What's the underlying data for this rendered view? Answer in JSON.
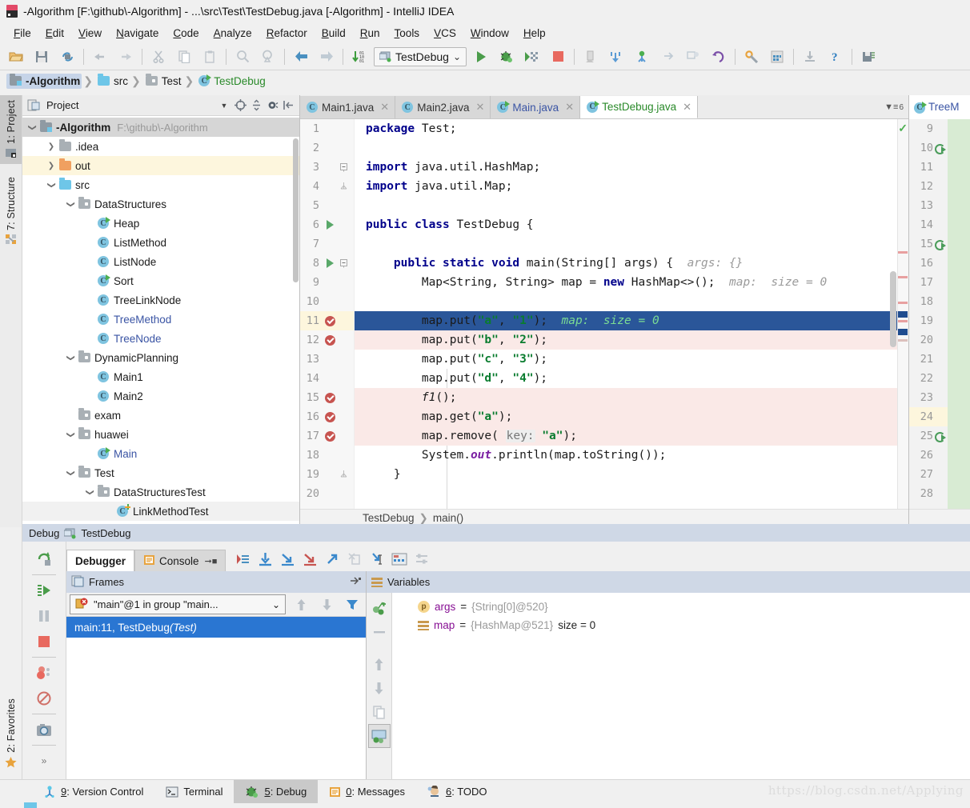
{
  "window": {
    "title": "-Algorithm [F:\\github\\-Algorithm] - ...\\src\\Test\\TestDebug.java [-Algorithm] - IntelliJ IDEA",
    "app_icon": "intellij-logo-icon"
  },
  "menubar": {
    "items": [
      "File",
      "Edit",
      "View",
      "Navigate",
      "Code",
      "Analyze",
      "Refactor",
      "Build",
      "Run",
      "Tools",
      "VCS",
      "Window",
      "Help"
    ]
  },
  "toolbar": {
    "buttons": [
      "open-folder-icon",
      "save-all-icon",
      "sync-icon",
      "undo-icon",
      "redo-icon",
      "cut-icon",
      "copy-icon",
      "paste-icon",
      "find-icon",
      "replace-icon",
      "back-icon",
      "forward-icon",
      "sort-icon"
    ],
    "run_config": {
      "label": "TestDebug",
      "icon": "run-configuration-icon",
      "chevron": "⌄"
    },
    "right_buttons": [
      "run-icon",
      "debug-icon",
      "run-coverage-icon",
      "stop-icon",
      "build-project-icon",
      "update-project-icon",
      "commit-icon",
      "push-icon",
      "rollback-icon",
      "revert-icon",
      "settings-icon",
      "project-structure-icon",
      "download-icon",
      "help-icon",
      "save-chip-icon"
    ]
  },
  "navbar": {
    "crumbs": [
      {
        "label": "-Algorithm",
        "icon": "project-folder-icon",
        "selected": true
      },
      {
        "label": "src",
        "icon": "source-folder-icon",
        "selected": false
      },
      {
        "label": "Test",
        "icon": "package-folder-icon",
        "selected": false
      },
      {
        "label": "TestDebug",
        "icon": "java-class-runnable-icon",
        "selected": false
      }
    ]
  },
  "left_stripe": {
    "top_buttons": [
      {
        "label": "1: Project",
        "key": "1",
        "icon": "project-tool-icon",
        "active": true
      },
      {
        "label": "7: Structure",
        "key": "7",
        "icon": "structure-tool-icon",
        "active": false
      }
    ],
    "bottom_buttons": [
      {
        "label": "2: Favorites",
        "key": "2",
        "icon": "favorites-star-icon",
        "active": false
      }
    ]
  },
  "project_panel": {
    "title": "Project",
    "header_icons": [
      "project-view-icon",
      "collapse-dropdown-icon",
      "locate-icon",
      "expand-collapse-icon",
      "gear-icon",
      "hide-icon"
    ],
    "tree": [
      {
        "depth": 0,
        "label": "-Algorithm",
        "sub": "F:\\github\\-Algorithm",
        "icon": "project-folder-icon",
        "chev": "down",
        "bold": true,
        "row": "selected-grey"
      },
      {
        "depth": 1,
        "label": ".idea",
        "icon": "folder-grey-icon",
        "chev": "right",
        "row": ""
      },
      {
        "depth": 1,
        "label": "out",
        "icon": "folder-orange-icon",
        "chev": "right",
        "row": "highlight"
      },
      {
        "depth": 1,
        "label": "src",
        "icon": "folder-blue-icon",
        "chev": "down",
        "row": ""
      },
      {
        "depth": 2,
        "label": "DataStructures",
        "icon": "package-folder-icon",
        "chev": "down",
        "row": ""
      },
      {
        "depth": 3,
        "label": "Heap",
        "icon": "java-class-runnable-icon",
        "chev": "",
        "row": ""
      },
      {
        "depth": 3,
        "label": "ListMethod",
        "icon": "java-class-icon",
        "chev": "",
        "row": ""
      },
      {
        "depth": 3,
        "label": "ListNode",
        "icon": "java-class-icon",
        "chev": "",
        "row": ""
      },
      {
        "depth": 3,
        "label": "Sort",
        "icon": "java-class-runnable-icon",
        "chev": "",
        "row": ""
      },
      {
        "depth": 3,
        "label": "TreeLinkNode",
        "icon": "java-class-icon",
        "chev": "",
        "row": ""
      },
      {
        "depth": 3,
        "label": "TreeMethod",
        "icon": "java-class-icon",
        "chev": "",
        "row": "",
        "blue": true
      },
      {
        "depth": 3,
        "label": "TreeNode",
        "icon": "java-class-icon",
        "chev": "",
        "row": "",
        "blue": true
      },
      {
        "depth": 2,
        "label": "DynamicPlanning",
        "icon": "package-folder-icon",
        "chev": "down",
        "row": ""
      },
      {
        "depth": 3,
        "label": "Main1",
        "icon": "java-class-icon",
        "chev": "",
        "row": ""
      },
      {
        "depth": 3,
        "label": "Main2",
        "icon": "java-class-icon",
        "chev": "",
        "row": ""
      },
      {
        "depth": 2,
        "label": "exam",
        "icon": "package-folder-icon",
        "chev": "",
        "row": ""
      },
      {
        "depth": 2,
        "label": "huawei",
        "icon": "package-folder-icon",
        "chev": "down",
        "row": ""
      },
      {
        "depth": 3,
        "label": "Main",
        "icon": "java-class-runnable-icon",
        "chev": "",
        "row": "",
        "blue": true
      },
      {
        "depth": 2,
        "label": "Test",
        "icon": "package-folder-icon",
        "chev": "down",
        "row": ""
      },
      {
        "depth": 3,
        "label": "DataStructuresTest",
        "icon": "package-folder-icon",
        "chev": "down",
        "row": ""
      },
      {
        "depth": 4,
        "label": "LinkMethodTest",
        "icon": "java-test-class-icon",
        "chev": "",
        "row": "faint"
      }
    ]
  },
  "editor": {
    "tabs": [
      {
        "label": "Main1.java",
        "icon": "java-class-icon",
        "active": false,
        "color": "grey"
      },
      {
        "label": "Main2.java",
        "icon": "java-class-icon",
        "active": false,
        "color": "grey"
      },
      {
        "label": "Main.java",
        "icon": "java-class-runnable-icon",
        "active": false,
        "color": "blue"
      },
      {
        "label": "TestDebug.java",
        "icon": "java-class-runnable-icon",
        "active": true,
        "color": "green"
      }
    ],
    "tab_overflow_label": "6",
    "inspection_status": "ok-check-icon",
    "breadcrumb": [
      "TestDebug",
      "main()"
    ],
    "lines": [
      {
        "n": 1,
        "indent": 0,
        "marker": "",
        "fold": "",
        "row": "",
        "tokens": [
          {
            "t": "kw",
            "v": "package"
          },
          {
            "t": "plain",
            "v": " Test;"
          }
        ]
      },
      {
        "n": 2,
        "indent": 0,
        "marker": "",
        "fold": "",
        "row": "",
        "tokens": []
      },
      {
        "n": 3,
        "indent": 0,
        "marker": "",
        "fold": "minus-open",
        "row": "",
        "tokens": [
          {
            "t": "kw",
            "v": "import"
          },
          {
            "t": "plain",
            "v": " java.util.HashMap;"
          }
        ]
      },
      {
        "n": 4,
        "indent": 0,
        "marker": "",
        "fold": "end",
        "row": "",
        "tokens": [
          {
            "t": "kw",
            "v": "import"
          },
          {
            "t": "plain",
            "v": " java.util.Map;"
          }
        ]
      },
      {
        "n": 5,
        "indent": 0,
        "marker": "",
        "fold": "",
        "row": "",
        "tokens": []
      },
      {
        "n": 6,
        "indent": 0,
        "marker": "run-arrow",
        "fold": "",
        "row": "",
        "tokens": [
          {
            "t": "kw",
            "v": "public class"
          },
          {
            "t": "plain",
            "v": " TestDebug {"
          }
        ]
      },
      {
        "n": 7,
        "indent": 0,
        "marker": "",
        "fold": "",
        "row": "",
        "tokens": []
      },
      {
        "n": 8,
        "indent": 1,
        "marker": "run-arrow",
        "fold": "minus-open",
        "row": "",
        "tokens": [
          {
            "t": "kw",
            "v": "public static void"
          },
          {
            "t": "plain",
            "v": " main(String[] args) {  "
          },
          {
            "t": "hint",
            "v": "args: {}"
          }
        ]
      },
      {
        "n": 9,
        "indent": 2,
        "marker": "",
        "fold": "",
        "row": "",
        "tokens": [
          {
            "t": "plain",
            "v": "Map<String, String> map = "
          },
          {
            "t": "kw",
            "v": "new"
          },
          {
            "t": "plain",
            "v": " HashMap<>();  "
          },
          {
            "t": "hint",
            "v": "map:  size = 0"
          }
        ]
      },
      {
        "n": 10,
        "indent": 0,
        "marker": "",
        "fold": "",
        "row": "",
        "tokens": []
      },
      {
        "n": 11,
        "indent": 2,
        "marker": "breakpoint",
        "fold": "",
        "row": "current",
        "tokens": [
          {
            "t": "plain",
            "v": "map.put("
          },
          {
            "t": "str",
            "v": "\"a\""
          },
          {
            "t": "plain",
            "v": ", "
          },
          {
            "t": "str",
            "v": "\"1\""
          },
          {
            "t": "plain",
            "v": ");  "
          },
          {
            "t": "hintg",
            "v": "map:  size = 0"
          }
        ]
      },
      {
        "n": 12,
        "indent": 2,
        "marker": "breakpoint",
        "fold": "",
        "row": "pink",
        "tokens": [
          {
            "t": "plain",
            "v": "map.put("
          },
          {
            "t": "str",
            "v": "\"b\""
          },
          {
            "t": "plain",
            "v": ", "
          },
          {
            "t": "str",
            "v": "\"2\""
          },
          {
            "t": "plain",
            "v": ");"
          }
        ]
      },
      {
        "n": 13,
        "indent": 2,
        "marker": "",
        "fold": "",
        "row": "",
        "tokens": [
          {
            "t": "plain",
            "v": "map.put("
          },
          {
            "t": "str",
            "v": "\"c\""
          },
          {
            "t": "plain",
            "v": ", "
          },
          {
            "t": "str",
            "v": "\"3\""
          },
          {
            "t": "plain",
            "v": ");"
          }
        ]
      },
      {
        "n": 14,
        "indent": 2,
        "marker": "",
        "fold": "",
        "row": "",
        "tokens": [
          {
            "t": "plain",
            "v": "map.put("
          },
          {
            "t": "str",
            "v": "\"d\""
          },
          {
            "t": "plain",
            "v": ", "
          },
          {
            "t": "str",
            "v": "\"4\""
          },
          {
            "t": "plain",
            "v": ");"
          }
        ]
      },
      {
        "n": 15,
        "indent": 2,
        "marker": "breakpoint",
        "fold": "",
        "row": "pink",
        "tokens": [
          {
            "t": "ital",
            "v": "f1"
          },
          {
            "t": "plain",
            "v": "();"
          }
        ]
      },
      {
        "n": 16,
        "indent": 2,
        "marker": "breakpoint",
        "fold": "",
        "row": "pink",
        "tokens": [
          {
            "t": "plain",
            "v": "map.get("
          },
          {
            "t": "str",
            "v": "\"a\""
          },
          {
            "t": "plain",
            "v": ");"
          }
        ]
      },
      {
        "n": 17,
        "indent": 2,
        "marker": "breakpoint",
        "fold": "",
        "row": "pink",
        "tokens": [
          {
            "t": "plain",
            "v": "map.remove( "
          },
          {
            "t": "pbadge",
            "v": "key:"
          },
          {
            "t": "plain",
            "v": " "
          },
          {
            "t": "str",
            "v": "\"a\""
          },
          {
            "t": "plain",
            "v": ");"
          }
        ]
      },
      {
        "n": 18,
        "indent": 2,
        "marker": "",
        "fold": "",
        "row": "",
        "tokens": [
          {
            "t": "plain",
            "v": "System."
          },
          {
            "t": "fld",
            "v": "out"
          },
          {
            "t": "plain",
            "v": ".println(map.toString());"
          }
        ]
      },
      {
        "n": 19,
        "indent": 1,
        "marker": "",
        "fold": "end",
        "row": "",
        "tokens": [
          {
            "t": "plain",
            "v": "}"
          }
        ]
      },
      {
        "n": 20,
        "indent": 0,
        "marker": "",
        "fold": "",
        "row": "",
        "tokens": []
      }
    ]
  },
  "right_editor": {
    "tab_label": "TreeM",
    "tab_icon": "java-class-runnable-icon",
    "lines": [
      {
        "n": 9,
        "icon": "",
        "row": ""
      },
      {
        "n": 10,
        "icon": "override-icon",
        "row": ""
      },
      {
        "n": 11,
        "icon": "",
        "row": ""
      },
      {
        "n": 12,
        "icon": "",
        "row": ""
      },
      {
        "n": 13,
        "icon": "",
        "row": ""
      },
      {
        "n": 14,
        "icon": "",
        "row": ""
      },
      {
        "n": 15,
        "icon": "override-icon",
        "row": ""
      },
      {
        "n": 16,
        "icon": "",
        "row": ""
      },
      {
        "n": 17,
        "icon": "",
        "row": ""
      },
      {
        "n": 18,
        "icon": "",
        "row": ""
      },
      {
        "n": 19,
        "icon": "",
        "row": ""
      },
      {
        "n": 20,
        "icon": "",
        "row": ""
      },
      {
        "n": 21,
        "icon": "",
        "row": ""
      },
      {
        "n": 22,
        "icon": "",
        "row": ""
      },
      {
        "n": 23,
        "icon": "",
        "row": ""
      },
      {
        "n": 24,
        "icon": "",
        "row": "highlight"
      },
      {
        "n": 25,
        "icon": "override-icon",
        "row": ""
      },
      {
        "n": 26,
        "icon": "",
        "row": ""
      },
      {
        "n": 27,
        "icon": "",
        "row": ""
      },
      {
        "n": 28,
        "icon": "",
        "row": ""
      }
    ]
  },
  "debug": {
    "header": {
      "label": "Debug",
      "config": "TestDebug",
      "icon": "run-configuration-icon"
    },
    "left_tools": [
      "rerun-icon",
      "resume-icon",
      "pause-icon",
      "stop-icon",
      "view-breakpoints-icon",
      "mute-breakpoints-icon",
      "settings-camera-icon",
      "more-icon"
    ],
    "tabs": [
      {
        "label": "Debugger",
        "icon": "",
        "active": true
      },
      {
        "label": "Console",
        "icon": "console-icon",
        "active": false
      }
    ],
    "tab_tools": [
      "restore-layout-icon",
      "step-over-icon",
      "step-into-icon",
      "force-step-into-icon",
      "step-out-icon",
      "drop-frame-icon",
      "run-to-cursor-icon",
      "evaluate-expression-icon",
      "settings-icon"
    ],
    "frames": {
      "title": "Frames",
      "title_icon": "frames-icon",
      "thread": "\"main\"@1 in group \"main...",
      "thread_icon": "thread-suspended-icon",
      "thread_chevron": "⌄",
      "toolbar_icons": [
        "arrow-up-icon",
        "arrow-down-icon",
        "filter-icon"
      ],
      "rows": [
        {
          "label": "main:11, TestDebug ",
          "italic": "(Test)",
          "selected": true
        }
      ]
    },
    "variables": {
      "title": "Variables",
      "title_icon": "variables-icon",
      "toolbar_icons": [
        "new-watch-icon",
        "remove-watch-icon",
        "arrow-up-icon",
        "arrow-down-icon",
        "copy-icon",
        "inline-watch-icon"
      ],
      "rows": [
        {
          "icon": "parameter-icon",
          "name": "args",
          "eq": " = ",
          "value": "{String[0]@520}",
          "extra": ""
        },
        {
          "icon": "map-icon",
          "name": "map",
          "eq": " = ",
          "value": "{HashMap@521}",
          "extra": "size = 0"
        }
      ]
    }
  },
  "statusbar": {
    "items": [
      {
        "label": "9: Version Control",
        "key": "9",
        "icon": "version-control-icon",
        "active": false
      },
      {
        "label": "Terminal",
        "key": "",
        "icon": "terminal-icon",
        "active": false
      },
      {
        "label": "5: Debug",
        "key": "5",
        "icon": "debug-bug-icon",
        "active": true
      },
      {
        "label": "0: Messages",
        "key": "0",
        "icon": "messages-icon",
        "active": false
      },
      {
        "label": "6: TODO",
        "key": "6",
        "icon": "todo-icon",
        "active": false
      }
    ],
    "watermark": "https://blog.csdn.net/Applying"
  },
  "colors": {
    "accent_blue": "#2a5699",
    "selection_blue": "#2a76d2",
    "breakpoint_red": "#c75450",
    "run_green": "#59a869",
    "pink_row": "#fae9e7",
    "highlight_yellow": "#fdf6dd"
  }
}
